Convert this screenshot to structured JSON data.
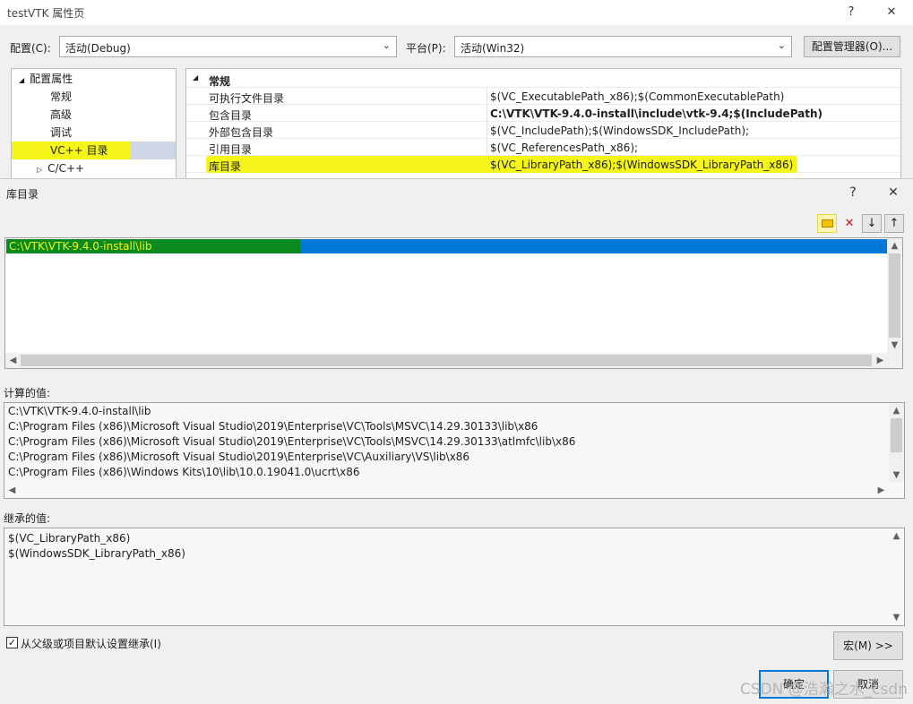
{
  "bg_window": {
    "title": "testVTK 属性页",
    "help_glyph": "?",
    "close_glyph": "✕",
    "config_label": "配置(C):",
    "config_value": "活动(Debug)",
    "platform_label": "平台(P):",
    "platform_value": "活动(Win32)",
    "config_manager_label": "配置管理器(O)...",
    "tree": [
      {
        "label": "配置属性",
        "expander": "◢"
      },
      {
        "label": "常规"
      },
      {
        "label": "高级"
      },
      {
        "label": "调试"
      },
      {
        "label": "VC++ 目录",
        "selected": true
      },
      {
        "label": "C/C++",
        "expander": "▷"
      }
    ],
    "grid_section": "常规",
    "grid_rows": [
      {
        "name": "可执行文件目录",
        "value": "$(VC_ExecutablePath_x86);$(CommonExecutablePath)"
      },
      {
        "name": "包含目录",
        "value": "C:\\VTK\\VTK-9.4.0-install\\include\\vtk-9.4;$(IncludePath)",
        "bold": true
      },
      {
        "name": "外部包含目录",
        "value": "$(VC_IncludePath);$(WindowsSDK_IncludePath);"
      },
      {
        "name": "引用目录",
        "value": "$(VC_ReferencesPath_x86);"
      },
      {
        "name": "库目录",
        "value": "$(VC_LibraryPath_x86);$(WindowsSDK_LibraryPath_x86)",
        "highlight": true
      }
    ]
  },
  "dialog": {
    "title": "库目录",
    "help_glyph": "?",
    "close_glyph": "✕",
    "toolbar": {
      "new_line_icon": "new-line-icon",
      "delete_glyph": "✕",
      "move_down_glyph": "↓",
      "move_up_glyph": "↑"
    },
    "entry": "C:\\VTK\\VTK-9.4.0-install\\lib",
    "computed_label": "计算的值:",
    "computed_values": [
      "C:\\VTK\\VTK-9.4.0-install\\lib",
      "C:\\Program Files (x86)\\Microsoft Visual Studio\\2019\\Enterprise\\VC\\Tools\\MSVC\\14.29.30133\\lib\\x86",
      "C:\\Program Files (x86)\\Microsoft Visual Studio\\2019\\Enterprise\\VC\\Tools\\MSVC\\14.29.30133\\atlmfc\\lib\\x86",
      "C:\\Program Files (x86)\\Microsoft Visual Studio\\2019\\Enterprise\\VC\\Auxiliary\\VS\\lib\\x86",
      "C:\\Program Files (x86)\\Windows Kits\\10\\lib\\10.0.19041.0\\ucrt\\x86"
    ],
    "inherited_label": "继承的值:",
    "inherited_values": [
      "$(VC_LibraryPath_x86)",
      "$(WindowsSDK_LibraryPath_x86)"
    ],
    "inherit_checkbox_label": "从父级或项目默认设置继承(I)",
    "inherit_checked": true,
    "macro_button": "宏(M) >>",
    "ok_button": "确定",
    "cancel_button": "取消"
  },
  "watermark": "CSDN @浩瀚之水_csdn",
  "colors": {
    "highlight_yellow": "#f5f51a",
    "selection_blue": "#0078d7",
    "entry_green": "#0a8a1e"
  }
}
